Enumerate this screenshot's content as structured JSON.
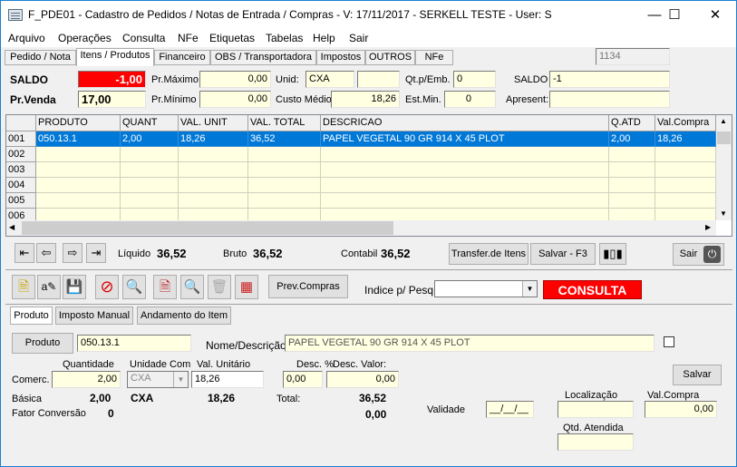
{
  "window": {
    "title": "F_PDE01 - Cadastro de Pedidos / Notas de Entrada / Compras - V: 17/11/2017 - SERKELL TESTE - User: S"
  },
  "menu": [
    "Arquivo",
    "Operações",
    "Consulta",
    "NFe",
    "Etiquetas",
    "Tabelas",
    "Help",
    "Sair"
  ],
  "tabs": [
    "Pedido / Nota",
    "Itens / Produtos",
    "Financeiro",
    "OBS / Transportadora",
    "Impostos",
    "OUTROS",
    "NFe"
  ],
  "tab_field": "1134",
  "top": {
    "saldo_label": "SALDO",
    "saldo_value": "-1,00",
    "prmax_label": "Pr.Máximo",
    "prmax_value": "0,00",
    "unid_label": "Unid:",
    "unid_value": "CXA",
    "unid_value2": "",
    "qtemb_label": "Qt.p/Emb.",
    "qtemb_value": "0",
    "saldo2_label": "SALDO",
    "saldo2_value": "-1",
    "prvenda_label": "Pr.Venda",
    "prvenda_value": "17,00",
    "prmin_label": "Pr.Mínimo",
    "prmin_value": "0,00",
    "custo_label": "Custo Médio",
    "custo_value": "18,26",
    "estmin_label": "Est.Min.",
    "estmin_value": "0",
    "apresent_label": "Apresent:",
    "apresent_value": ""
  },
  "grid": {
    "columns": [
      "PRODUTO",
      "QUANT",
      "VAL. UNIT",
      "VAL. TOTAL",
      "DESCRICAO",
      "Q.ATD",
      "Val.Compra"
    ],
    "row_numbers": [
      "001",
      "002",
      "003",
      "004",
      "005",
      "006"
    ],
    "rows": [
      [
        "050.13.1",
        "2,00",
        "18,26",
        "36,52",
        "PAPEL VEGETAL 90 GR 914 X 45 PLOT",
        "2,00",
        "18,26"
      ]
    ]
  },
  "totals": {
    "liquido_label": "Líquido",
    "liquido": "36,52",
    "bruto_label": "Bruto",
    "bruto": "36,52",
    "contabil_label": "Contabil",
    "contabil": "36,52"
  },
  "buttons": {
    "transfer": "Transfer.de Itens",
    "salvar_f3": "Salvar - F3",
    "sair": "Sair",
    "prev_compras": "Prev.Compras",
    "salvar": "Salvar",
    "produto": "Produto"
  },
  "indice_label": "Indice p/ Pesq",
  "indice_value": "",
  "status": "CONSULTA",
  "subtabs": [
    "Produto",
    "Imposto Manual",
    "Andamento do Item"
  ],
  "detail": {
    "produto_code": "050.13.1",
    "nome_label": "Nome/Descrição:",
    "nome_value": "PAPEL VEGETAL 90 GR 914 X 45 PLOT",
    "quantidade_label": "Quantidade",
    "unidade_com_label": "Unidade Com",
    "val_unit_label": "Val. Unitário",
    "desc_pct_label": "Desc. %",
    "desc_valor_label": "Desc. Valor:",
    "comerc_label": "Comerc.",
    "quantidade": "2,00",
    "unidade_com": "CXA",
    "val_unit": "18,26",
    "desc_pct": "0,00",
    "desc_valor": "0,00",
    "basica_label": "Básica",
    "basica_qtd": "2,00",
    "basica_unid": "CXA",
    "basica_val": "18,26",
    "total_label": "Total:",
    "total": "36,52",
    "total2": "0,00",
    "fator_label": "Fator Conversão",
    "fator": "0",
    "validade_label": "Validade",
    "validade": "__/__/__",
    "localizacao_label": "Localização",
    "localizacao": "",
    "val_compra_label": "Val.Compra",
    "val_compra": "0,00",
    "qtd_atendida_label": "Qtd. Atendida",
    "qtd_atendida": ""
  },
  "colors": {
    "saldo_bg": "#ff0000",
    "field_bg": "#ffffe1",
    "selection": "#0078d7",
    "consulta_bg": "#ff0000"
  }
}
